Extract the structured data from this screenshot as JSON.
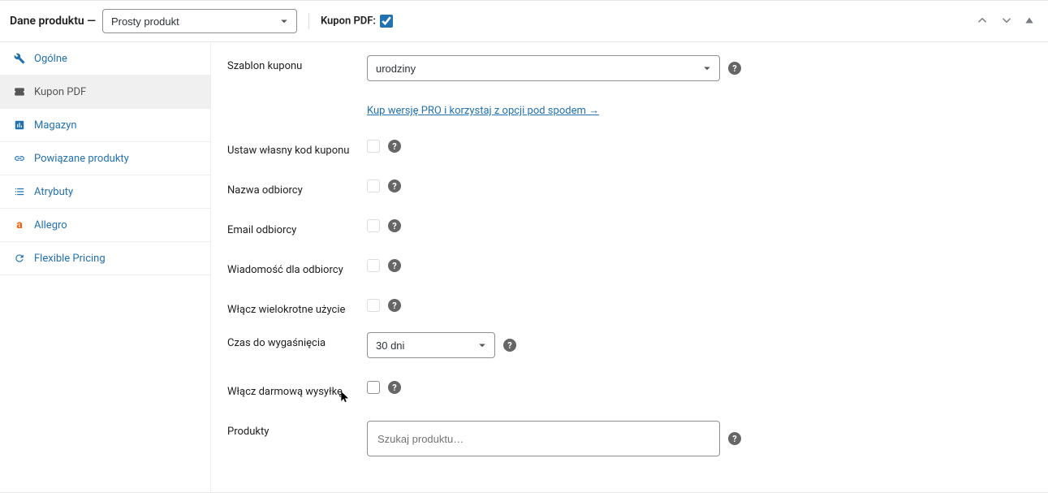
{
  "header": {
    "title": "Dane produktu",
    "dash": " — ",
    "product_type": "Prosty produkt",
    "kupon_pdf_label": "Kupon PDF:"
  },
  "tabs": {
    "general": "Ogólne",
    "kupon_pdf": "Kupon PDF",
    "inventory": "Magazyn",
    "linked": "Powiązane produkty",
    "attributes": "Atrybuty",
    "allegro": "Allegro",
    "flexible_pricing": "Flexible Pricing"
  },
  "form": {
    "template_label": "Szablon kuponu",
    "template_value": "urodziny",
    "pro_link": "Kup wersję PRO i korzystaj z opcji pod spodem →",
    "custom_code_label": "Ustaw własny kod kuponu",
    "recipient_name_label": "Nazwa odbiorcy",
    "recipient_email_label": "Email odbiorcy",
    "recipient_message_label": "Wiadomość dla odbiorcy",
    "multiple_use_label": "Włącz wielokrotne użycie",
    "expiration_label": "Czas do wygaśnięcia",
    "expiration_value": "30 dni",
    "free_shipping_label": "Włącz darmową wysyłkę",
    "products_label": "Produkty",
    "products_placeholder": "Szukaj produktu…"
  }
}
